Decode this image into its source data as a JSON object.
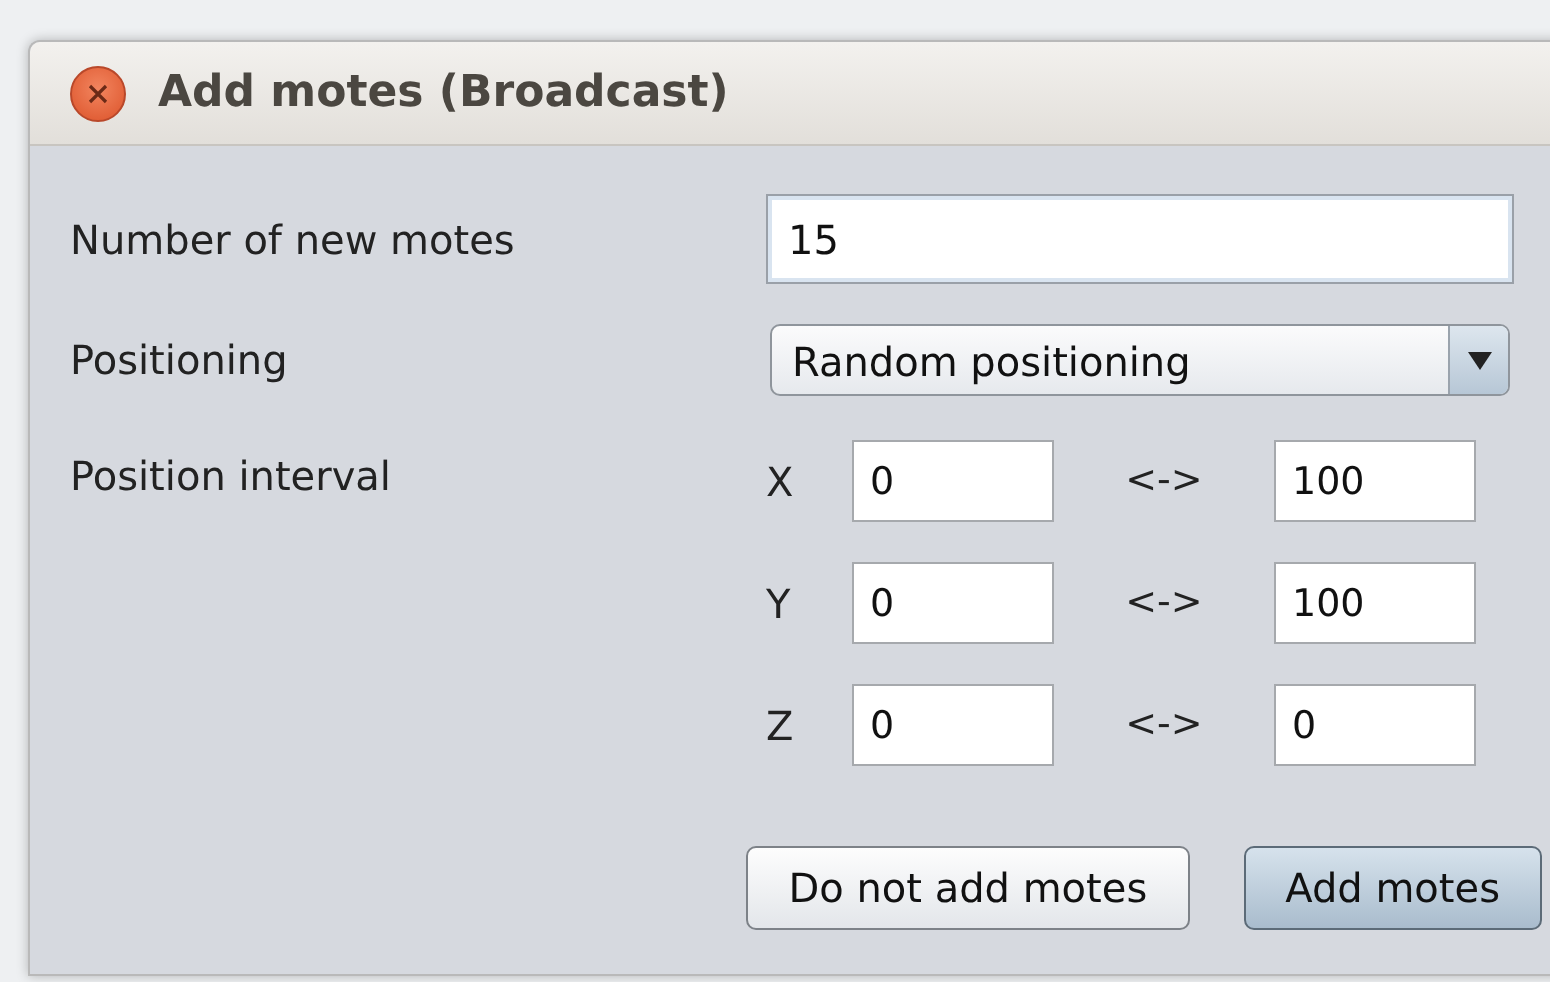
{
  "window": {
    "title": "Add motes (Broadcast)"
  },
  "fields": [
    {
      "label": "Number of new motes",
      "kind": "text",
      "value": "15"
    },
    {
      "label": "Positioning",
      "kind": "dropdown",
      "value": "Random positioning"
    },
    {
      "label": "Position interval",
      "kind": "interval",
      "axes": [
        {
          "axis": "X",
          "from": "0",
          "separator": "<->",
          "to": "100"
        },
        {
          "axis": "Y",
          "from": "0",
          "separator": "<->",
          "to": "100"
        },
        {
          "axis": "Z",
          "from": "0",
          "separator": "<->",
          "to": "0"
        }
      ]
    }
  ],
  "buttons": [
    {
      "label": "Do not add motes",
      "default": false
    },
    {
      "label": "Add motes",
      "default": true
    }
  ]
}
